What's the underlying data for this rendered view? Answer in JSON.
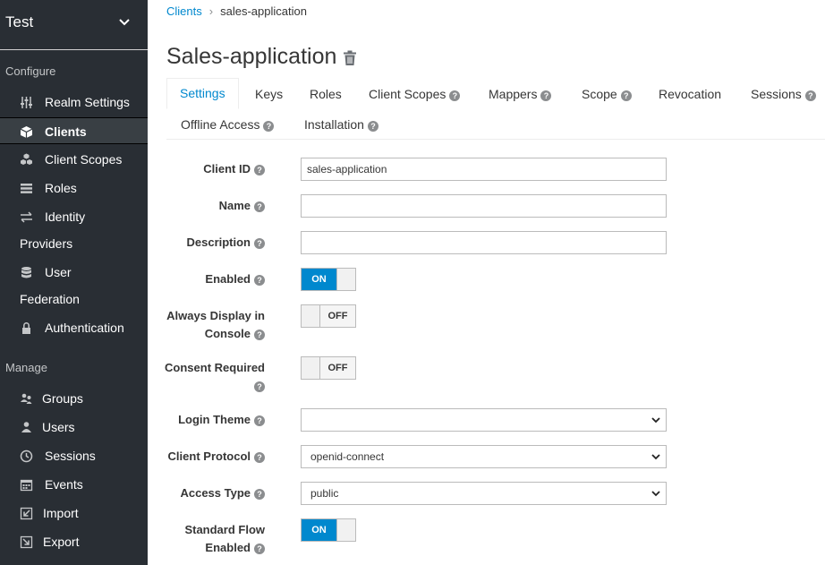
{
  "realm": {
    "name": "Test"
  },
  "sidebar": {
    "configure_label": "Configure",
    "manage_label": "Manage",
    "configure_items": [
      {
        "label": "Realm Settings"
      },
      {
        "label": "Clients"
      },
      {
        "label": "Client Scopes"
      },
      {
        "label": "Roles"
      },
      {
        "label": "Identity",
        "label2": "Providers"
      },
      {
        "label": "User",
        "label2": "Federation"
      },
      {
        "label": "Authentication"
      }
    ],
    "manage_items": [
      {
        "label": "Groups"
      },
      {
        "label": "Users"
      },
      {
        "label": "Sessions"
      },
      {
        "label": "Events"
      },
      {
        "label": "Import"
      },
      {
        "label": "Export"
      }
    ]
  },
  "breadcrumb": {
    "parent": "Clients",
    "current": "sales-application"
  },
  "page": {
    "title": "Sales-application"
  },
  "tabs": [
    {
      "label": "Settings"
    },
    {
      "label": "Keys"
    },
    {
      "label": "Roles"
    },
    {
      "label": "Client Scopes"
    },
    {
      "label": "Mappers"
    },
    {
      "label": "Scope"
    },
    {
      "label": "Revocation"
    },
    {
      "label": "Sessions"
    },
    {
      "label": "Offline Access"
    },
    {
      "label": "Installation"
    }
  ],
  "form": {
    "client_id": {
      "label": "Client ID",
      "value": "sales-application"
    },
    "name": {
      "label": "Name",
      "value": ""
    },
    "description": {
      "label": "Description",
      "value": ""
    },
    "enabled": {
      "label": "Enabled",
      "state": "ON"
    },
    "always_display": {
      "label1": "Always Display in",
      "label2": "Console",
      "state": "OFF"
    },
    "consent_required": {
      "label": "Consent Required",
      "state": "OFF"
    },
    "login_theme": {
      "label": "Login Theme",
      "value": ""
    },
    "client_protocol": {
      "label": "Client Protocol",
      "value": "openid-connect"
    },
    "access_type": {
      "label": "Access Type",
      "value": "public"
    },
    "standard_flow": {
      "label1": "Standard Flow",
      "label2": "Enabled",
      "state": "ON"
    }
  },
  "colors": {
    "accent": "#0088ce",
    "sidebar": "#292e34",
    "sidebar_active": "#393f44"
  }
}
